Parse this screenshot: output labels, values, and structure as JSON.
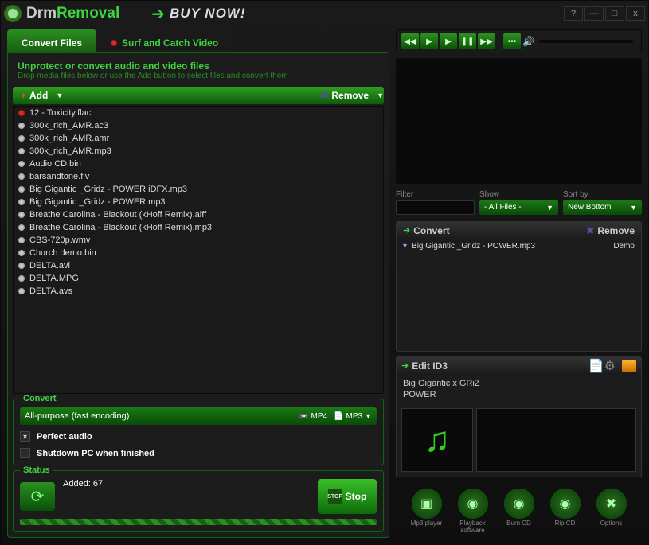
{
  "titlebar": {
    "logo": {
      "part1": "Drm",
      "part2": "Removal"
    },
    "buy_now": "BUY NOW!"
  },
  "tabs": {
    "convert": "Convert Files",
    "surf": "Surf and Catch Video"
  },
  "panel": {
    "title": "Unprotect or convert audio and video files",
    "subtitle": "Drop media files below or use the Add button to select files and convert them"
  },
  "toolbar": {
    "add": "Add",
    "remove": "Remove"
  },
  "files": [
    {
      "name": "12 - Toxicity.flac",
      "playing": true
    },
    {
      "name": "300k_rich_AMR.ac3"
    },
    {
      "name": "300k_rich_AMR.amr"
    },
    {
      "name": "300k_rich_AMR.mp3"
    },
    {
      "name": "Audio CD.bin"
    },
    {
      "name": "barsandtone.flv"
    },
    {
      "name": "Big Gigantic _Gridz - POWER iDFX.mp3"
    },
    {
      "name": "Big Gigantic _Gridz - POWER.mp3"
    },
    {
      "name": "Breathe Carolina - Blackout (kHoff Remix).aiff"
    },
    {
      "name": "Breathe Carolina - Blackout (kHoff Remix).mp3"
    },
    {
      "name": "CBS-720p.wmv"
    },
    {
      "name": "Church demo.bin"
    },
    {
      "name": "DELTA.avi"
    },
    {
      "name": "DELTA.MPG"
    },
    {
      "name": "DELTA.avs"
    }
  ],
  "convert": {
    "label": "Convert",
    "profile": "All-purpose (fast encoding)",
    "fmt1": "MP4",
    "fmt2": "MP3"
  },
  "options": {
    "perfect_audio": "Perfect audio",
    "perfect_audio_checked": true,
    "shutdown": "Shutdown PC when finished",
    "shutdown_checked": false
  },
  "status": {
    "label": "Status",
    "text": "Added: 67",
    "stop": "Stop",
    "stop_octa": "STOP"
  },
  "filters": {
    "filter_label": "Filter",
    "show_label": "Show",
    "show_value": "- All Files -",
    "sort_label": "Sort by",
    "sort_value": "New Bottom"
  },
  "queue": {
    "convert_title": "Convert",
    "remove": "Remove",
    "items": [
      {
        "name": "Big Gigantic _Gridz - POWER.mp3",
        "status": "Demo"
      }
    ]
  },
  "id3": {
    "title": "Edit ID3",
    "line1": "Big Gigantic x GRiZ",
    "line2": "POWER"
  },
  "bbtns": {
    "mp3": "Mp3 player",
    "playback": "Playback software",
    "burn": "Burn CD",
    "rip": "Rip CD",
    "options": "Options"
  }
}
